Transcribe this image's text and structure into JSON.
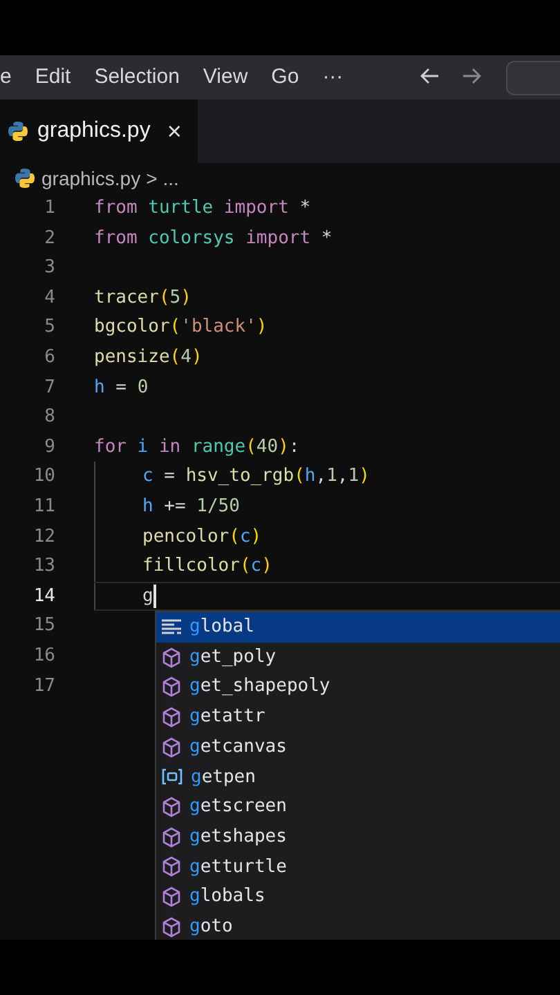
{
  "menu_bar": {
    "items": [
      "e",
      "Edit",
      "Selection",
      "View",
      "Go",
      "···"
    ]
  },
  "tab": {
    "label": "graphics.py",
    "close": "×",
    "selected": true
  },
  "breadcrumb": {
    "file": "graphics.py",
    "separator": ">",
    "rest": "..."
  },
  "editor": {
    "lines": [
      {
        "number": "1",
        "active": false,
        "indented": false,
        "tokens": [
          {
            "text": "from",
            "kind": "keyword"
          },
          {
            "text": " turtle",
            "kind": "module"
          },
          {
            "text": " import",
            "kind": "keyword"
          },
          {
            "text": " *",
            "kind": "plain"
          }
        ]
      },
      {
        "number": "2",
        "active": false,
        "indented": false,
        "tokens": [
          {
            "text": "from",
            "kind": "keyword"
          },
          {
            "text": " colorsys",
            "kind": "module"
          },
          {
            "text": " import",
            "kind": "keyword"
          },
          {
            "text": " *",
            "kind": "plain"
          }
        ]
      },
      {
        "number": "3",
        "active": false,
        "indented": false
      },
      {
        "number": "4",
        "active": false,
        "indented": false,
        "tokens": [
          {
            "text": "tracer",
            "kind": "function"
          },
          {
            "text": "(",
            "kind": "paren"
          },
          {
            "text": "5",
            "kind": "number"
          },
          {
            "text": ")",
            "kind": "paren"
          }
        ]
      },
      {
        "number": "5",
        "active": false,
        "indented": false,
        "tokens": [
          {
            "text": "bgcolor",
            "kind": "function"
          },
          {
            "text": "(",
            "kind": "paren"
          },
          {
            "text": "'black'",
            "kind": "string"
          },
          {
            "text": ")",
            "kind": "paren"
          }
        ]
      },
      {
        "number": "6",
        "active": false,
        "indented": false,
        "tokens": [
          {
            "text": "pensize",
            "kind": "function"
          },
          {
            "text": "(",
            "kind": "paren"
          },
          {
            "text": "4",
            "kind": "number"
          },
          {
            "text": ")",
            "kind": "paren"
          }
        ]
      },
      {
        "number": "7",
        "active": false,
        "indented": false,
        "tokens": [
          {
            "text": "h",
            "kind": "variable"
          },
          {
            "text": " = ",
            "kind": "plain"
          },
          {
            "text": "0",
            "kind": "number"
          }
        ]
      },
      {
        "number": "8",
        "active": false,
        "indented": false
      },
      {
        "number": "9",
        "active": false,
        "indented": false,
        "tokens": [
          {
            "text": "for",
            "kind": "keyword"
          },
          {
            "text": " i",
            "kind": "variable"
          },
          {
            "text": " in",
            "kind": "keyword"
          },
          {
            "text": " range",
            "kind": "module"
          },
          {
            "text": "(",
            "kind": "paren"
          },
          {
            "text": "40",
            "kind": "number"
          },
          {
            "text": ")",
            "kind": "paren"
          },
          {
            "text": ":",
            "kind": "plain"
          }
        ]
      },
      {
        "number": "10",
        "active": false,
        "indented": true,
        "tokens": [
          {
            "text": "c",
            "kind": "variable"
          },
          {
            "text": " = ",
            "kind": "plain"
          },
          {
            "text": "hsv_to_rgb",
            "kind": "function"
          },
          {
            "text": "(",
            "kind": "paren"
          },
          {
            "text": "h",
            "kind": "variable"
          },
          {
            "text": ",",
            "kind": "plain"
          },
          {
            "text": "1",
            "kind": "number"
          },
          {
            "text": ",",
            "kind": "plain"
          },
          {
            "text": "1",
            "kind": "number"
          },
          {
            "text": ")",
            "kind": "paren"
          }
        ]
      },
      {
        "number": "11",
        "active": false,
        "indented": true,
        "tokens": [
          {
            "text": "h",
            "kind": "variable"
          },
          {
            "text": " += ",
            "kind": "plain"
          },
          {
            "text": "1/50",
            "kind": "number"
          }
        ]
      },
      {
        "number": "12",
        "active": false,
        "indented": true,
        "tokens": [
          {
            "text": "pencolor",
            "kind": "function"
          },
          {
            "text": "(",
            "kind": "paren"
          },
          {
            "text": "c",
            "kind": "variable"
          },
          {
            "text": ")",
            "kind": "paren"
          }
        ]
      },
      {
        "number": "13",
        "active": false,
        "indented": true,
        "tokens": [
          {
            "text": "fillcolor",
            "kind": "function"
          },
          {
            "text": "(",
            "kind": "paren"
          },
          {
            "text": "c",
            "kind": "variable"
          },
          {
            "text": ")",
            "kind": "paren"
          }
        ]
      },
      {
        "number": "14",
        "active": true,
        "indented": true,
        "tokens": [
          {
            "text": "g",
            "kind": "plain"
          }
        ]
      },
      {
        "number": "15",
        "active": false,
        "indented": false
      },
      {
        "number": "16",
        "active": false,
        "indented": false
      },
      {
        "number": "17",
        "active": false,
        "indented": false
      }
    ]
  },
  "suggestions": [
    {
      "match": "g",
      "rest": "lobal",
      "kind": "keyword",
      "selected": true
    },
    {
      "match": "g",
      "rest": "et_poly",
      "kind": "method",
      "selected": false
    },
    {
      "match": "g",
      "rest": "et_shapepoly",
      "kind": "method",
      "selected": false
    },
    {
      "match": "g",
      "rest": "etattr",
      "kind": "method",
      "selected": false
    },
    {
      "match": "g",
      "rest": "etcanvas",
      "kind": "method",
      "selected": false
    },
    {
      "match": "g",
      "rest": "etpen",
      "kind": "variable",
      "selected": false
    },
    {
      "match": "g",
      "rest": "etscreen",
      "kind": "method",
      "selected": false
    },
    {
      "match": "g",
      "rest": "etshapes",
      "kind": "method",
      "selected": false
    },
    {
      "match": "g",
      "rest": "etturtle",
      "kind": "method",
      "selected": false
    },
    {
      "match": "g",
      "rest": "lobals",
      "kind": "method",
      "selected": false
    },
    {
      "match": "g",
      "rest": "oto",
      "kind": "method",
      "selected": false
    }
  ]
}
